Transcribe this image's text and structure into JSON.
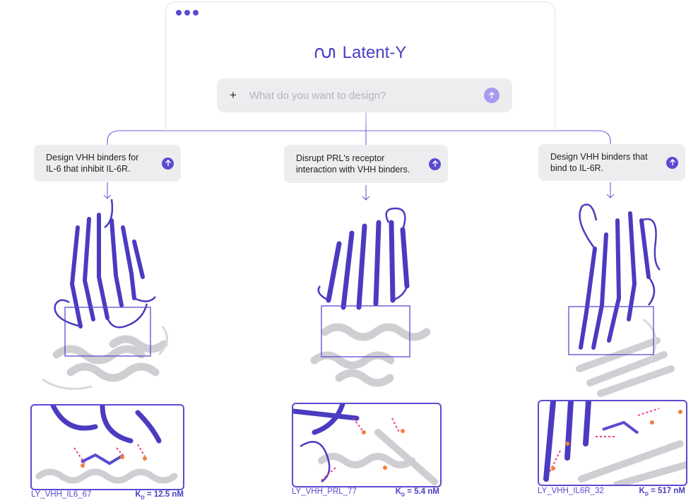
{
  "app": {
    "brand": "Latent-Y"
  },
  "prompt": {
    "plus": "+",
    "placeholder": "What do you want to design?"
  },
  "branches": [
    {
      "line1": "Design VHH binders for",
      "line2": "IL-6 that inhibit IL-6R.",
      "id": "LY_VHH_IL6_67",
      "kd_label": "K",
      "kd_sub": "D",
      "kd_value": "= 12.5 nM"
    },
    {
      "line1": "Disrupt PRL's receptor",
      "line2": "interaction with VHH binders.",
      "id": "LY_VHH_PRL_77",
      "kd_label": "K",
      "kd_sub": "D",
      "kd_value": "= 5.4 nM"
    },
    {
      "line1": "Design VHH binders that",
      "line2": "bind to IL-6R.",
      "id": "LY_VHH_IL6R_32",
      "kd_label": "K",
      "kd_sub": "D",
      "kd_value": "= 517 nM"
    }
  ],
  "colors": {
    "accent": "#5a4bd0",
    "accent_light": "#a79af0",
    "card_bg": "#ededef",
    "grey_protein": "#c8c8cc"
  },
  "icons": {
    "send": "arrow-up-icon",
    "logo": "wave-logo-icon",
    "connector": "arrow-down-icon"
  }
}
